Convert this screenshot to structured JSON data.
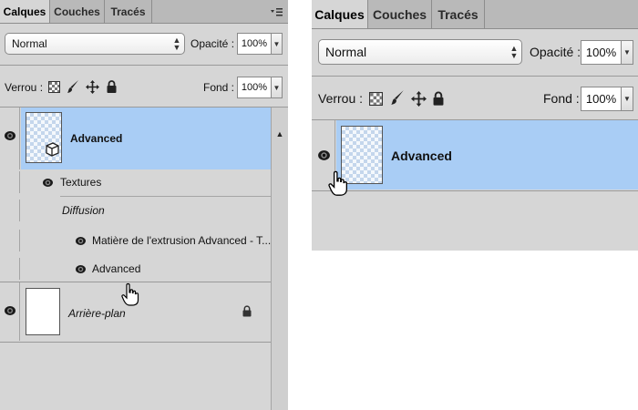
{
  "left_panel": {
    "tabs": [
      "Calques",
      "Couches",
      "Tracés"
    ],
    "active_tab": "Calques",
    "menu_icon": "panel-menu-icon",
    "blend_mode": "Normal",
    "opacity_label": "Opacité :",
    "opacity_value": "100%",
    "lock_label": "Verrou :",
    "fill_label": "Fond :",
    "fill_value": "100%",
    "layers": {
      "advanced": {
        "name": "Advanced",
        "selected": true,
        "effects_group": "Textures",
        "sublayer_group": "Diffusion",
        "items": [
          "Matière de l'extrusion Advanced - T...",
          "Advanced"
        ]
      },
      "background": {
        "name": "Arrière-plan",
        "locked": true
      }
    }
  },
  "right_panel": {
    "tabs": [
      "Calques",
      "Couches",
      "Tracés"
    ],
    "active_tab": "Calques",
    "blend_mode": "Normal",
    "opacity_label": "Opacité :",
    "opacity_value": "100%",
    "lock_label": "Verrou :",
    "fill_label": "Fond :",
    "fill_value": "100%",
    "layer_name": "Advanced"
  },
  "colors": {
    "selection": "#a9cdf5",
    "panel_bg": "#d6d6d6",
    "tab_bar": "#b9b9b9"
  }
}
